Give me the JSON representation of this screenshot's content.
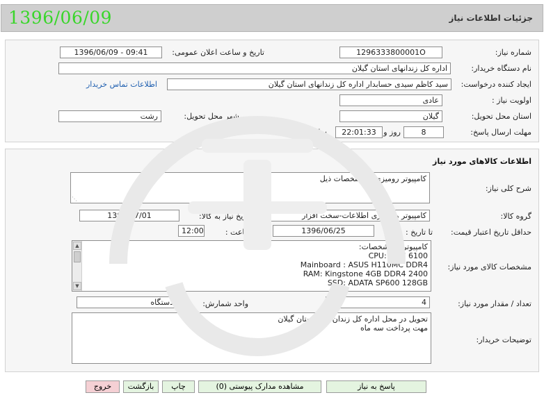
{
  "header": {
    "title": "جزئیات اطلاعات نیاز",
    "date_badge": "1396/06/09"
  },
  "need_info": {
    "need_number_label": "شماره نیاز:",
    "need_number": "1296333800001O",
    "announce_datetime_label": "تاریخ و ساعت اعلان عمومی:",
    "announce_datetime": "1396/06/09 - 09:41",
    "buyer_org_label": "نام دستگاه خریدار:",
    "buyer_org": "اداره کل زندانهای استان گیلان",
    "requester_label": "ایجاد کننده درخواست:",
    "requester": "سید کاظم سیدی حسابدار اداره کل زندانهای استان گیلان",
    "buyer_contact_link": "اطلاعات تماس خریدار",
    "priority_label": "اولویت نیاز :",
    "priority": "عادی",
    "delivery_province_label": "استان محل تحویل:",
    "delivery_province": "گیلان",
    "delivery_city_label": "شهر محل تحویل:",
    "delivery_city": "رشت",
    "deadline_label": "مهلت ارسال پاسخ:",
    "deadline_days": "8",
    "days_word": "روز و",
    "deadline_time": "22:01:33",
    "remaining_label": "ساعت باقی مانده"
  },
  "goods": {
    "section_title": "اطلاعات کالاهای مورد نیاز",
    "summary_label": "شرح کلی نیاز:",
    "summary": "کامپیوتر رومیزی با مشخصات ذیل",
    "goods_group_label": "گروه کالا:",
    "goods_group": "کامپیوتر و فناوری اطلاعات-سخت افزار",
    "need_date_label": "تاریخ نیاز به کالا:",
    "need_date": "1396/07/01",
    "min_price_validity_label": "حداقل تاریخ اعتبار قیمت:",
    "until_date_label": "تا تاریخ :",
    "until_date": "1396/06/25",
    "time_label": "ساعت :",
    "time": "12:00",
    "specs_label": "مشخصات کالای مورد نیاز:",
    "specs_lines": [
      "کامپیوتر با مشخصات:",
      "CPU: Intel 6100",
      "Mainboard : ASUS H110MC DDR4",
      "RAM: Kingstone 4GB DDR4 2400",
      "SSD: ADATA SP600 128GB"
    ],
    "quantity_label": "تعداد / مقدار مورد نیاز:",
    "quantity": "4",
    "unit_label": "واحد شمارش:",
    "unit": "دستگاه",
    "buyer_notes_label": "توضیحات خریدار:",
    "buyer_notes_lines": [
      "تحویل در محل اداره کل زندان های استان گیلان",
      "مهت پرداخت سه ماه"
    ]
  },
  "actions": {
    "respond": "پاسخ به نیاز",
    "view_attachments": "مشاهده مدارک پیوستی (0)",
    "print": "چاپ",
    "back": "بازگشت",
    "exit": "خروج"
  },
  "colors": {
    "date_badge": "#39d62a",
    "link": "#1f5fb0",
    "button_green": "#e4f4e0",
    "button_red": "#f5d0d4"
  }
}
